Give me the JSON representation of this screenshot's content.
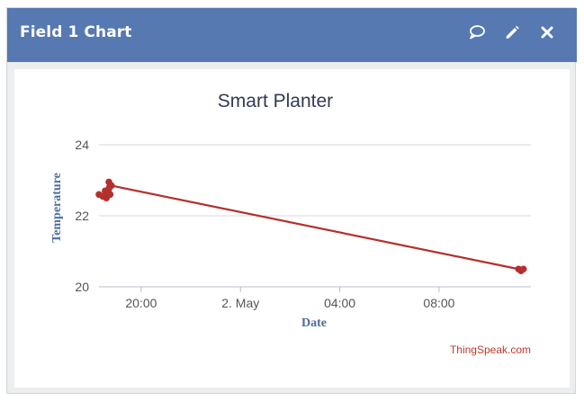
{
  "widget": {
    "title": "Field 1 Chart",
    "icons": [
      "comment-icon",
      "pencil-icon",
      "close-icon"
    ],
    "header_color": "#5679b2",
    "line_color": "#b3302c"
  },
  "chart_data": {
    "type": "line",
    "title": "Smart Planter",
    "xlabel": "Date",
    "ylabel": "Temperature",
    "x_tick_labels": [
      "20:00",
      "2. May",
      "04:00",
      "08:00"
    ],
    "x_ticks_hours": [
      20,
      24,
      28,
      32
    ],
    "y_ticks": [
      20,
      22,
      24
    ],
    "ylim": [
      20,
      24
    ],
    "xlim_hours": [
      18.3,
      35.7
    ],
    "grid": true,
    "series": [
      {
        "x_hours": [
          18.3,
          18.45,
          18.55,
          18.6,
          18.65,
          18.7,
          18.72,
          18.75,
          18.8,
          35.2,
          35.3,
          35.4
        ],
        "values": [
          22.6,
          22.55,
          22.7,
          22.5,
          22.65,
          22.95,
          22.8,
          22.6,
          22.85,
          20.5,
          20.45,
          20.5
        ]
      }
    ],
    "credit": "ThingSpeak.com"
  }
}
